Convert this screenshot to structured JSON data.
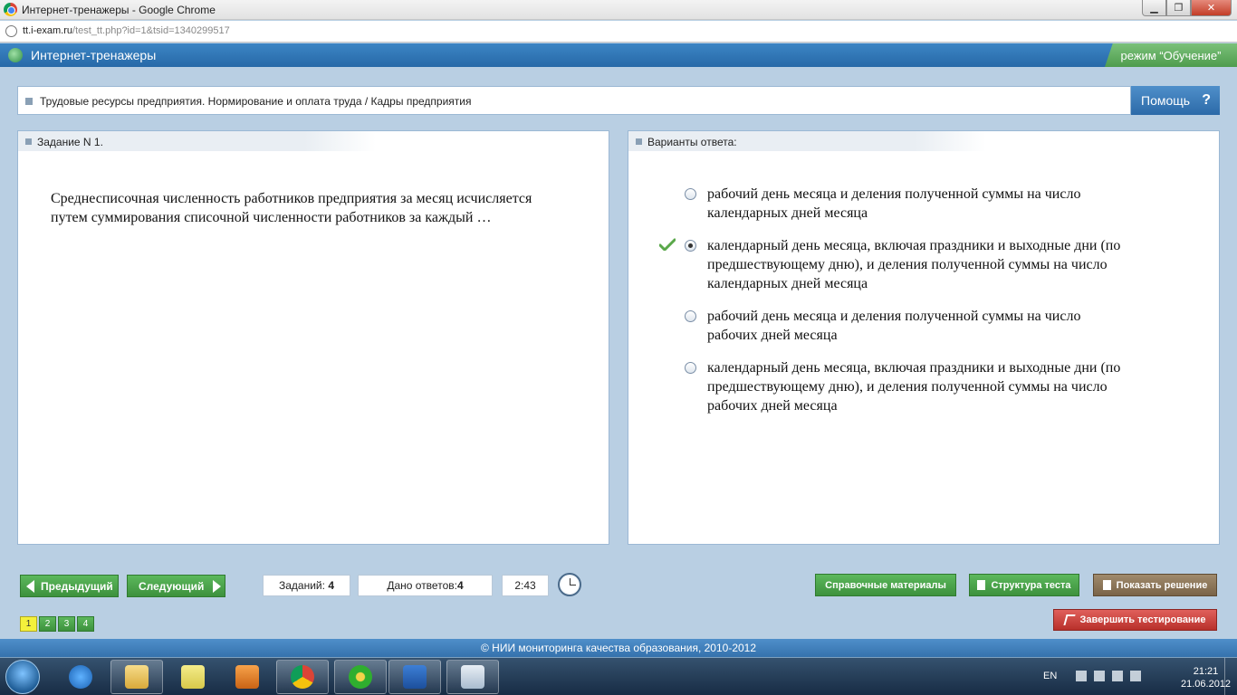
{
  "browser": {
    "window_title": "Интернет-тренажеры - Google Chrome",
    "url_host": "tt.i-exam.ru",
    "url_path": "/test_tt.php?id=1&tsid=1340299517"
  },
  "app": {
    "title": "Интернет-тренажеры",
    "mode": "режим “Обучение”"
  },
  "breadcrumb": "Трудовые ресурсы предприятия. Нормирование и оплата труда / Кадры предприятия",
  "help_label": "Помощь",
  "help_mark": "?",
  "task": {
    "header": "Задание N 1.",
    "question": "Среднесписочная численность работников предприятия за месяц исчисляется путем суммирования списочной численности работников за каждый …"
  },
  "answers": {
    "header": "Варианты ответа:",
    "options": [
      {
        "text": "рабочий день месяца и деления полученной суммы на число календарных дней месяца",
        "selected": false
      },
      {
        "text": "календарный день месяца, включая праздники и выходные дни (по предшествующему дню), и деления полученной суммы на число календарных дней месяца",
        "selected": true
      },
      {
        "text": "рабочий день месяца и деления полученной суммы на число рабочих дней месяца",
        "selected": false
      },
      {
        "text": "календарный день месяца, включая праздники и выходные дни (по предшествующему дню), и деления полученной суммы на число рабочих дней месяца",
        "selected": false
      }
    ]
  },
  "toolbar": {
    "prev": "Предыдущий",
    "next": "Следующий",
    "tasks_label": "Заданий:",
    "tasks_count": "4",
    "answered_label": "Дано ответов:",
    "answered_count": "4",
    "timer": "2:43",
    "reference": "Справочные материалы",
    "structure": "Структура теста",
    "solution": "Показать решение",
    "finish": "Завершить тестирование"
  },
  "pages": [
    "1",
    "2",
    "3",
    "4"
  ],
  "copyright": "© НИИ мониторинга качества образования, 2010-2012",
  "taskbar": {
    "lang": "EN",
    "time": "21:21",
    "date": "21.06.2012"
  },
  "colors": {
    "accent_blue": "#2c6aa8",
    "button_green": "#4ca64c",
    "finish_red": "#c8403a"
  }
}
